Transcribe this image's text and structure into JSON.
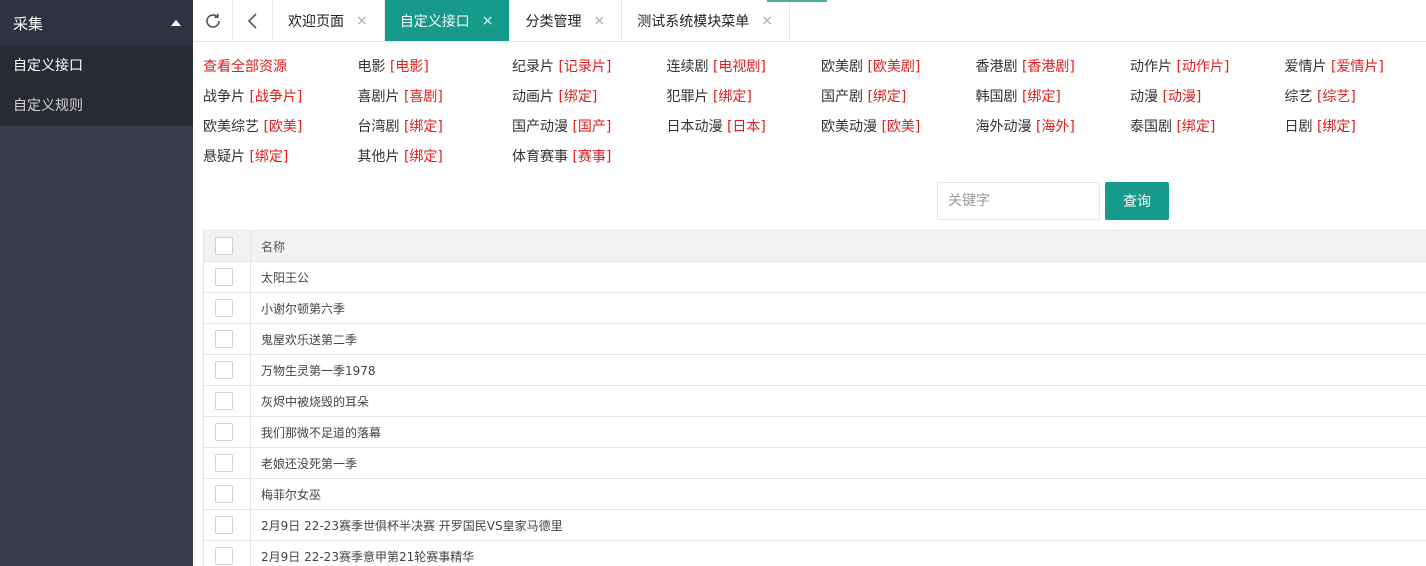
{
  "sidebar": {
    "group_label": "采集",
    "items": [
      {
        "label": "自定义接口",
        "active": true
      },
      {
        "label": "自定义规则",
        "active": false
      }
    ]
  },
  "tabs": {
    "tools": {
      "refresh": "refresh-icon",
      "back": "chevron-left-icon"
    },
    "items": [
      {
        "label": "欢迎页面",
        "close": "×"
      },
      {
        "label": "自定义接口",
        "close": "×"
      },
      {
        "label": "分类管理",
        "close": "×"
      },
      {
        "label": "测试系统模块菜单",
        "close": "×"
      }
    ]
  },
  "categories": [
    {
      "name": "查看全部资源",
      "tag": ""
    },
    {
      "name": "电影",
      "tag": "[电影]"
    },
    {
      "name": "纪录片",
      "tag": "[记录片]"
    },
    {
      "name": "连续剧",
      "tag": "[电视剧]"
    },
    {
      "name": "欧美剧",
      "tag": "[欧美剧]"
    },
    {
      "name": "香港剧",
      "tag": "[香港剧]"
    },
    {
      "name": "动作片",
      "tag": "[动作片]"
    },
    {
      "name": "爱情片",
      "tag": "[爱情片]"
    },
    {
      "name": "战争片",
      "tag": "[战争片]"
    },
    {
      "name": "喜剧片",
      "tag": "[喜剧]"
    },
    {
      "name": "动画片",
      "tag": "[绑定]"
    },
    {
      "name": "犯罪片",
      "tag": "[绑定]"
    },
    {
      "name": "国产剧",
      "tag": "[绑定]"
    },
    {
      "name": "韩国剧",
      "tag": "[绑定]"
    },
    {
      "name": "动漫",
      "tag": "[动漫]"
    },
    {
      "name": "综艺",
      "tag": "[综艺]"
    },
    {
      "name": "欧美综艺",
      "tag": "[欧美]"
    },
    {
      "name": "台湾剧",
      "tag": "[绑定]"
    },
    {
      "name": "国产动漫",
      "tag": "[国产]"
    },
    {
      "name": "日本动漫",
      "tag": "[日本]"
    },
    {
      "name": "欧美动漫",
      "tag": "[欧美]"
    },
    {
      "name": "海外动漫",
      "tag": "[海外]"
    },
    {
      "name": "泰国剧",
      "tag": "[绑定]"
    },
    {
      "name": "日剧",
      "tag": "[绑定]"
    },
    {
      "name": "悬疑片",
      "tag": "[绑定]"
    },
    {
      "name": "其他片",
      "tag": "[绑定]"
    },
    {
      "name": "体育赛事",
      "tag": "[赛事]"
    }
  ],
  "search": {
    "placeholder": "关键字",
    "value": "",
    "button_label": "查询"
  },
  "table": {
    "header": "名称",
    "rows": [
      "太阳王公",
      "小谢尔顿第六季",
      "鬼屋欢乐送第二季",
      "万物生灵第一季1978",
      "灰烬中被烧毁的耳朵",
      "我们那微不足道的落幕",
      "老娘还没死第一季",
      "梅菲尔女巫",
      "2月9日 22-23赛季世俱杯半决赛 开罗国民VS皇家马德里",
      "2月9日 22-23赛季意甲第21轮赛事精华"
    ]
  },
  "colors": {
    "accent": "#169a8c",
    "sidebar": "#393d49",
    "tag_red": "#e01e1e"
  }
}
